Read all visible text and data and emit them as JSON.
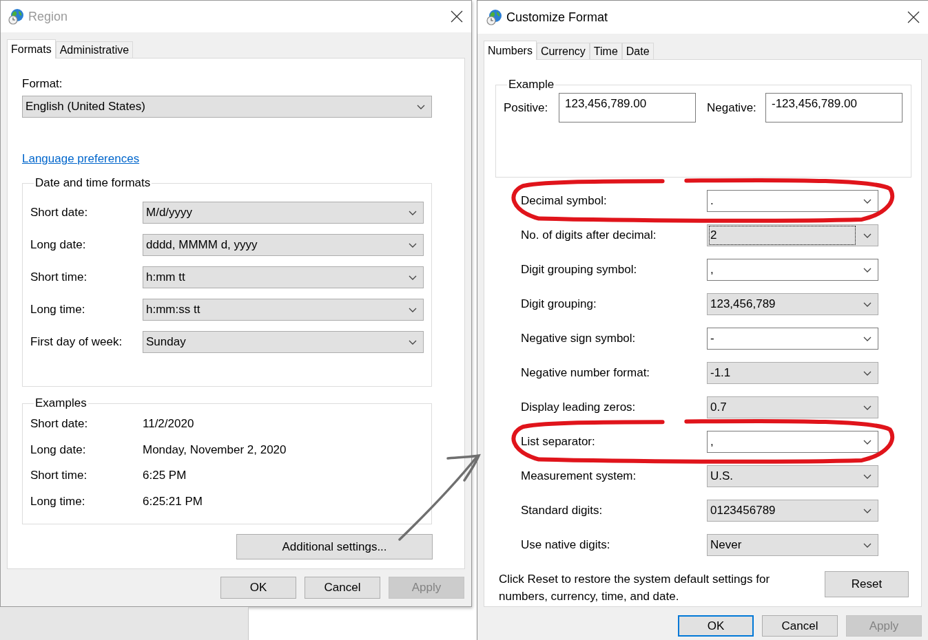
{
  "region_dialog": {
    "title": "Region",
    "active": false,
    "tabs": [
      {
        "label": "Formats",
        "selected": true
      },
      {
        "label": "Administrative",
        "selected": false
      }
    ],
    "format": {
      "label": "Format:",
      "value": "English (United States)"
    },
    "language_link": "Language preferences",
    "date_time_formats": {
      "title": "Date and time formats",
      "rows": [
        {
          "label": "Short date:",
          "value": "M/d/yyyy"
        },
        {
          "label": "Long date:",
          "value": "dddd, MMMM d, yyyy"
        },
        {
          "label": "Short time:",
          "value": "h:mm tt"
        },
        {
          "label": "Long time:",
          "value": "h:mm:ss tt"
        },
        {
          "label": "First day of week:",
          "value": "Sunday"
        }
      ]
    },
    "examples": {
      "title": "Examples",
      "rows": [
        {
          "label": "Short date:",
          "value": "11/2/2020"
        },
        {
          "label": "Long date:",
          "value": "Monday, November 2, 2020"
        },
        {
          "label": "Short time:",
          "value": "6:25 PM"
        },
        {
          "label": "Long time:",
          "value": "6:25:21 PM"
        }
      ]
    },
    "additional_settings_button": "Additional settings...",
    "buttons": [
      {
        "label": "OK",
        "default": false,
        "disabled": false
      },
      {
        "label": "Cancel",
        "default": false,
        "disabled": false
      },
      {
        "label": "Apply",
        "default": false,
        "disabled": true
      }
    ]
  },
  "customize_dialog": {
    "title": "Customize Format",
    "active": true,
    "tabs": [
      {
        "label": "Numbers",
        "selected": true
      },
      {
        "label": "Currency",
        "selected": false
      },
      {
        "label": "Time",
        "selected": false
      },
      {
        "label": "Date",
        "selected": false
      }
    ],
    "example": {
      "title": "Example",
      "positive_label": "Positive:",
      "positive_value": "123,456,789.00",
      "negative_label": "Negative:",
      "negative_value": "-123,456,789.00"
    },
    "settings": [
      {
        "label": "Decimal symbol:",
        "value": ".",
        "kind": "editable",
        "focused": false,
        "circled": true
      },
      {
        "label": "No. of digits after decimal:",
        "value": "2",
        "kind": "list",
        "focused": true,
        "circled": false
      },
      {
        "label": "Digit grouping symbol:",
        "value": ",",
        "kind": "editable",
        "focused": false,
        "circled": false
      },
      {
        "label": "Digit grouping:",
        "value": "123,456,789",
        "kind": "list",
        "focused": false,
        "circled": false
      },
      {
        "label": "Negative sign symbol:",
        "value": "-",
        "kind": "editable",
        "focused": false,
        "circled": false
      },
      {
        "label": "Negative number format:",
        "value": "-1.1",
        "kind": "list",
        "focused": false,
        "circled": false
      },
      {
        "label": "Display leading zeros:",
        "value": "0.7",
        "kind": "list",
        "focused": false,
        "circled": false
      },
      {
        "label": "List separator:",
        "value": ",",
        "kind": "editable",
        "focused": false,
        "circled": true
      },
      {
        "label": "Measurement system:",
        "value": "U.S.",
        "kind": "list",
        "focused": false,
        "circled": false
      },
      {
        "label": "Standard digits:",
        "value": "0123456789",
        "kind": "list",
        "focused": false,
        "circled": false
      },
      {
        "label": "Use native digits:",
        "value": "Never",
        "kind": "list",
        "focused": false,
        "circled": false
      }
    ],
    "reset_text": "Click Reset to restore the system default settings for numbers, currency, time, and date.",
    "reset_button": "Reset",
    "buttons": [
      {
        "label": "OK",
        "default": true,
        "disabled": false
      },
      {
        "label": "Cancel",
        "default": false,
        "disabled": false
      },
      {
        "label": "Apply",
        "default": false,
        "disabled": true
      }
    ]
  }
}
